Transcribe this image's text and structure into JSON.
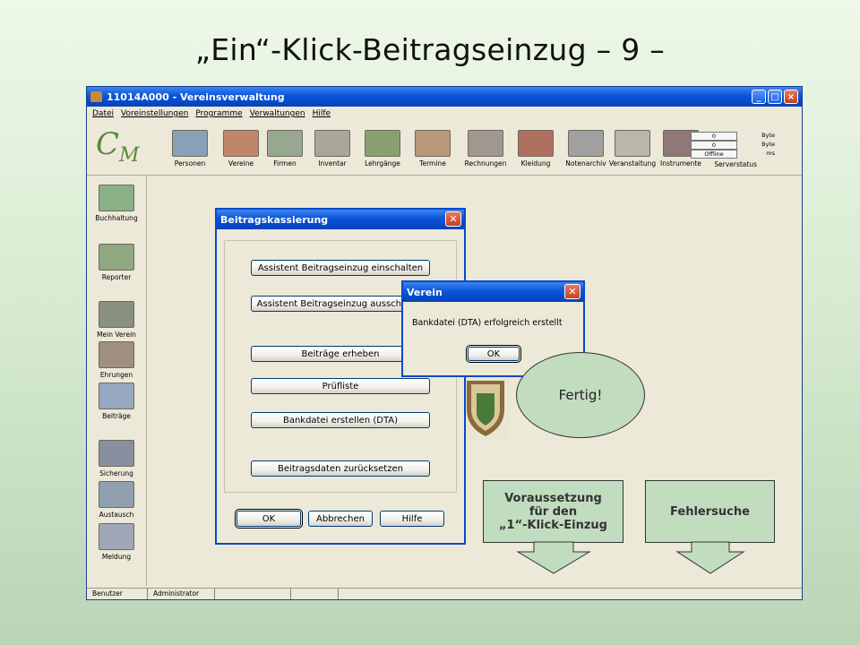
{
  "slide": {
    "title": "„Ein“-Klick-Beitragseinzug   – 9 –"
  },
  "app": {
    "title": "11014A000 - Vereinsverwaltung",
    "logo": "CvM",
    "window_buttons": [
      "_",
      "□",
      "×"
    ],
    "menu": [
      "Datei",
      "Voreinstellungen",
      "Programme",
      "Verwaltungen",
      "Hilfe"
    ],
    "toolbar": [
      {
        "label": "Personen",
        "icon": "people-icon",
        "color": "#8aa0b8"
      },
      {
        "label": "Vereine",
        "icon": "group-icon",
        "color": "#c0866a"
      },
      {
        "label": "Firmen",
        "icon": "building-icon",
        "color": "#98a890"
      },
      {
        "label": "Inventar",
        "icon": "inventory-icon",
        "color": "#a8a898"
      },
      {
        "label": "Lehrgänge",
        "icon": "course-icon",
        "color": "#88a070"
      },
      {
        "label": "Termine",
        "icon": "calendar-icon",
        "color": "#b89878"
      },
      {
        "label": "Rechnungen",
        "icon": "invoice-icon",
        "color": "#a09890"
      },
      {
        "label": "Kleidung",
        "icon": "clothing-icon",
        "color": "#b07060"
      },
      {
        "label": "Notenarchiv",
        "icon": "sheet-music-icon",
        "color": "#a0a0a0"
      },
      {
        "label": "Veranstaltung",
        "icon": "event-icon",
        "color": "#b8b8a8"
      },
      {
        "label": "Instrumente",
        "icon": "instrument-icon",
        "color": "#907878"
      }
    ],
    "server": {
      "values": [
        "0",
        "0",
        "Offline"
      ],
      "units": [
        "Byte",
        "Byte",
        "ms"
      ],
      "label": "Serverstatus"
    },
    "sidebar": [
      {
        "label": "Buchhaltung",
        "icon": "money-icon",
        "color": "#8ab088"
      },
      {
        "label": "Reporter",
        "icon": "reporter-icon",
        "color": "#90a880"
      },
      {
        "label": "Mein Verein",
        "icon": "club-icon",
        "color": "#8a9080"
      },
      {
        "label": "Ehrungen",
        "icon": "award-icon",
        "color": "#a09080"
      },
      {
        "label": "Beiträge",
        "icon": "fees-icon",
        "color": "#98a8c0"
      },
      {
        "label": "Sicherung",
        "icon": "laptop-icon",
        "color": "#8890a0"
      },
      {
        "label": "Austausch",
        "icon": "exchange-icon",
        "color": "#90a0b0"
      },
      {
        "label": "Meldung",
        "icon": "report-icon",
        "color": "#a0a8b8"
      }
    ],
    "statusbar": [
      "Benutzer",
      "Administrator",
      "",
      ""
    ]
  },
  "beitrag_dialog": {
    "title": "Beitragskassierung",
    "buttons": [
      "Assistent Beitragseinzug einschalten",
      "Assistent Beitragseinzug ausschalten",
      "Beiträge erheben",
      "Prüfliste",
      "Bankdatei erstellen (DTA)",
      "Beitragsdaten zurücksetzen"
    ],
    "ok": "OK",
    "cancel": "Abbrechen",
    "help": "Hilfe"
  },
  "verein_dialog": {
    "title": "Verein",
    "message": "Bankdatei (DTA) erfolgreich erstellt",
    "ok": "OK"
  },
  "callouts": {
    "done": "Fertig!",
    "prerequisite": [
      "Voraussetzung",
      "für den",
      "„1“-Klick-Einzug"
    ],
    "troubleshooting": "Fehlersuche"
  },
  "colors": {
    "xp_blue": "#0a55d8",
    "window_bg": "#ece9d8",
    "callout_fill": "#c2dcc0"
  }
}
